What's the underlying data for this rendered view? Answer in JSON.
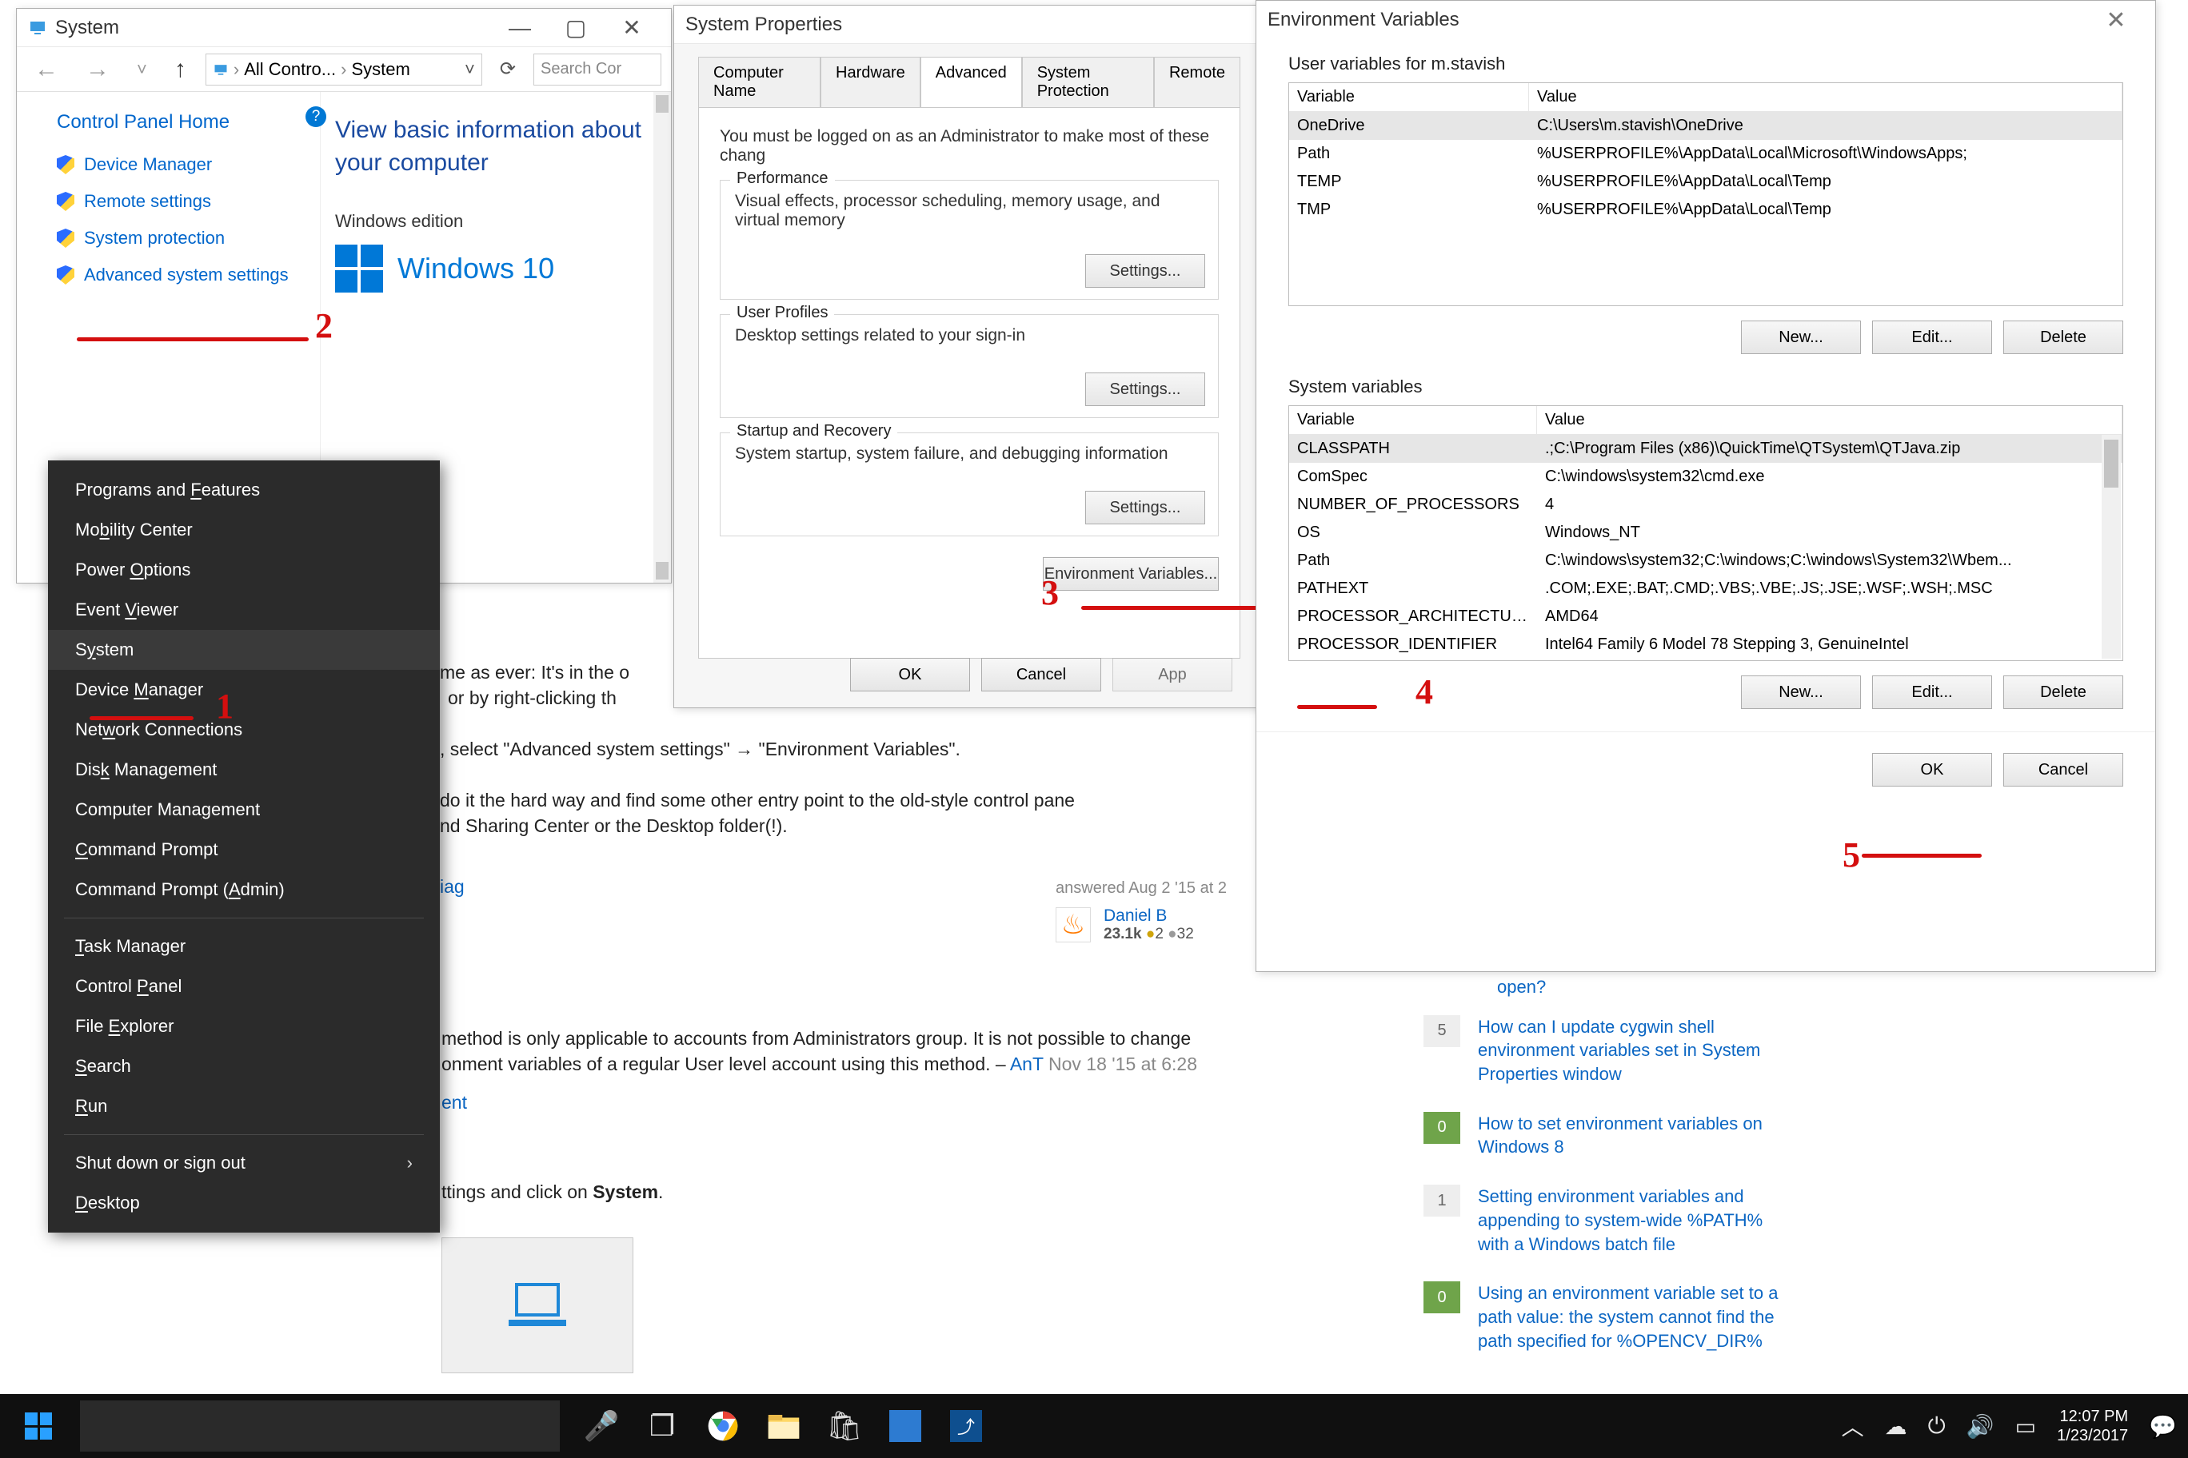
{
  "sysWin": {
    "title": "System",
    "breadcrumbs": {
      "root_icon": "pc-icon",
      "first": "All Contro...",
      "second": "System"
    },
    "search_placeholder": "Search Cor",
    "cp_home": "Control Panel Home",
    "links": [
      {
        "label": "Device Manager"
      },
      {
        "label": "Remote settings"
      },
      {
        "label": "System protection"
      },
      {
        "label": "Advanced system settings"
      }
    ],
    "main_h": "View basic information about your computer",
    "win_edition_h": "Windows edition",
    "win10_text": "Windows 10"
  },
  "propWin": {
    "title": "System Properties",
    "tabs": [
      "Computer Name",
      "Hardware",
      "Advanced",
      "System Protection",
      "Remote"
    ],
    "active_tab": 2,
    "note": "You must be logged on as an Administrator to make most of these chang",
    "groups": {
      "perf": {
        "head": "Performance",
        "body": "Visual effects, processor scheduling, memory usage, and virtual memory",
        "btn": "Settings..."
      },
      "prof": {
        "head": "User Profiles",
        "body": "Desktop settings related to your sign-in",
        "btn": "Settings..."
      },
      "start": {
        "head": "Startup and Recovery",
        "body": "System startup, system failure, and debugging information",
        "btn": "Settings..."
      }
    },
    "env_btn": "Environment Variables...",
    "ok": "OK",
    "cancel": "Cancel",
    "apply": "App"
  },
  "envWin": {
    "title": "Environment Variables",
    "user_lbl": "User variables for m.stavish",
    "hdr_var": "Variable",
    "hdr_val": "Value",
    "user_rows": [
      {
        "v": "OneDrive",
        "val": "C:\\Users\\m.stavish\\OneDrive"
      },
      {
        "v": "Path",
        "val": "%USERPROFILE%\\AppData\\Local\\Microsoft\\WindowsApps;"
      },
      {
        "v": "TEMP",
        "val": "%USERPROFILE%\\AppData\\Local\\Temp"
      },
      {
        "v": "TMP",
        "val": "%USERPROFILE%\\AppData\\Local\\Temp"
      }
    ],
    "sys_lbl": "System variables",
    "sys_rows": [
      {
        "v": "CLASSPATH",
        "val": ".;C:\\Program Files (x86)\\QuickTime\\QTSystem\\QTJava.zip"
      },
      {
        "v": "ComSpec",
        "val": "C:\\windows\\system32\\cmd.exe"
      },
      {
        "v": "NUMBER_OF_PROCESSORS",
        "val": "4"
      },
      {
        "v": "OS",
        "val": "Windows_NT"
      },
      {
        "v": "Path",
        "val": "C:\\windows\\system32;C:\\windows;C:\\windows\\System32\\Wbem..."
      },
      {
        "v": "PATHEXT",
        "val": ".COM;.EXE;.BAT;.CMD;.VBS;.VBE;.JS;.JSE;.WSF;.WSH;.MSC"
      },
      {
        "v": "PROCESSOR_ARCHITECTURE",
        "val": "AMD64"
      },
      {
        "v": "PROCESSOR_IDENTIFIER",
        "val": "Intel64 Family 6 Model 78 Stepping 3, GenuineIntel"
      }
    ],
    "btn_new": "New...",
    "btn_edit": "Edit...",
    "btn_del": "Delete",
    "btn_ok": "OK",
    "btn_cancel": "Cancel"
  },
  "winx_items": [
    "Programs and Features",
    "Mobility Center",
    "Power Options",
    "Event Viewer",
    "System",
    "Device Manager",
    "Network Connections",
    "Disk Management",
    "Computer Management",
    "Command Prompt",
    "Command Prompt (Admin)",
    "---",
    "Task Manager",
    "Control Panel",
    "File Explorer",
    "Search",
    "Run",
    "---",
    "Shut down or sign out",
    "Desktop"
  ],
  "bg": {
    "line1a": "me as ever: It's in the o",
    "line1b": " or by right-clicking th",
    "line2": ", select \"Advanced system settings\" → \"Environment Variables\".",
    "line3": " do it the hard way and find some other entry point to the old-style control pane",
    "line4": "nd Sharing Center or the Desktop folder(!).",
    "tag": "iag",
    "answered": "answered Aug 2 '15 at 2",
    "user": "Daniel B",
    "rep": "23.1k",
    "gold": "2",
    "silver": "32",
    "comment": "method is only applicable to accounts from Administrators group. It is not possible to change",
    "comment2": "onment variables of a regular User level account using this method. – ",
    "commenter": "AnT",
    "cdate": " Nov 18 '15 at 6:28",
    "addc": "ent",
    "ans2": "ttings and click on ",
    "ans2b": "System",
    "ans2c": "."
  },
  "related": [
    {
      "n": "",
      "ans": false,
      "t": "open?",
      "top": true
    },
    {
      "n": "5",
      "ans": false,
      "t": "How can I update cygwin shell environment variables set in System Properties window"
    },
    {
      "n": "0",
      "ans": true,
      "t": "How to set environment variables on Windows 8"
    },
    {
      "n": "1",
      "ans": false,
      "t": "Setting environment variables and appending to system-wide %PATH% with a Windows batch file"
    },
    {
      "n": "0",
      "ans": true,
      "t": "Using an environment variable set to a path value: the system cannot find the path specified for %OPENCV_DIR%"
    }
  ],
  "annotations": {
    "n1": "1",
    "n2": "2",
    "n3": "3",
    "n4": "4",
    "n5": "5"
  },
  "taskbar": {
    "time": "12:07 PM",
    "date": "1/23/2017"
  }
}
